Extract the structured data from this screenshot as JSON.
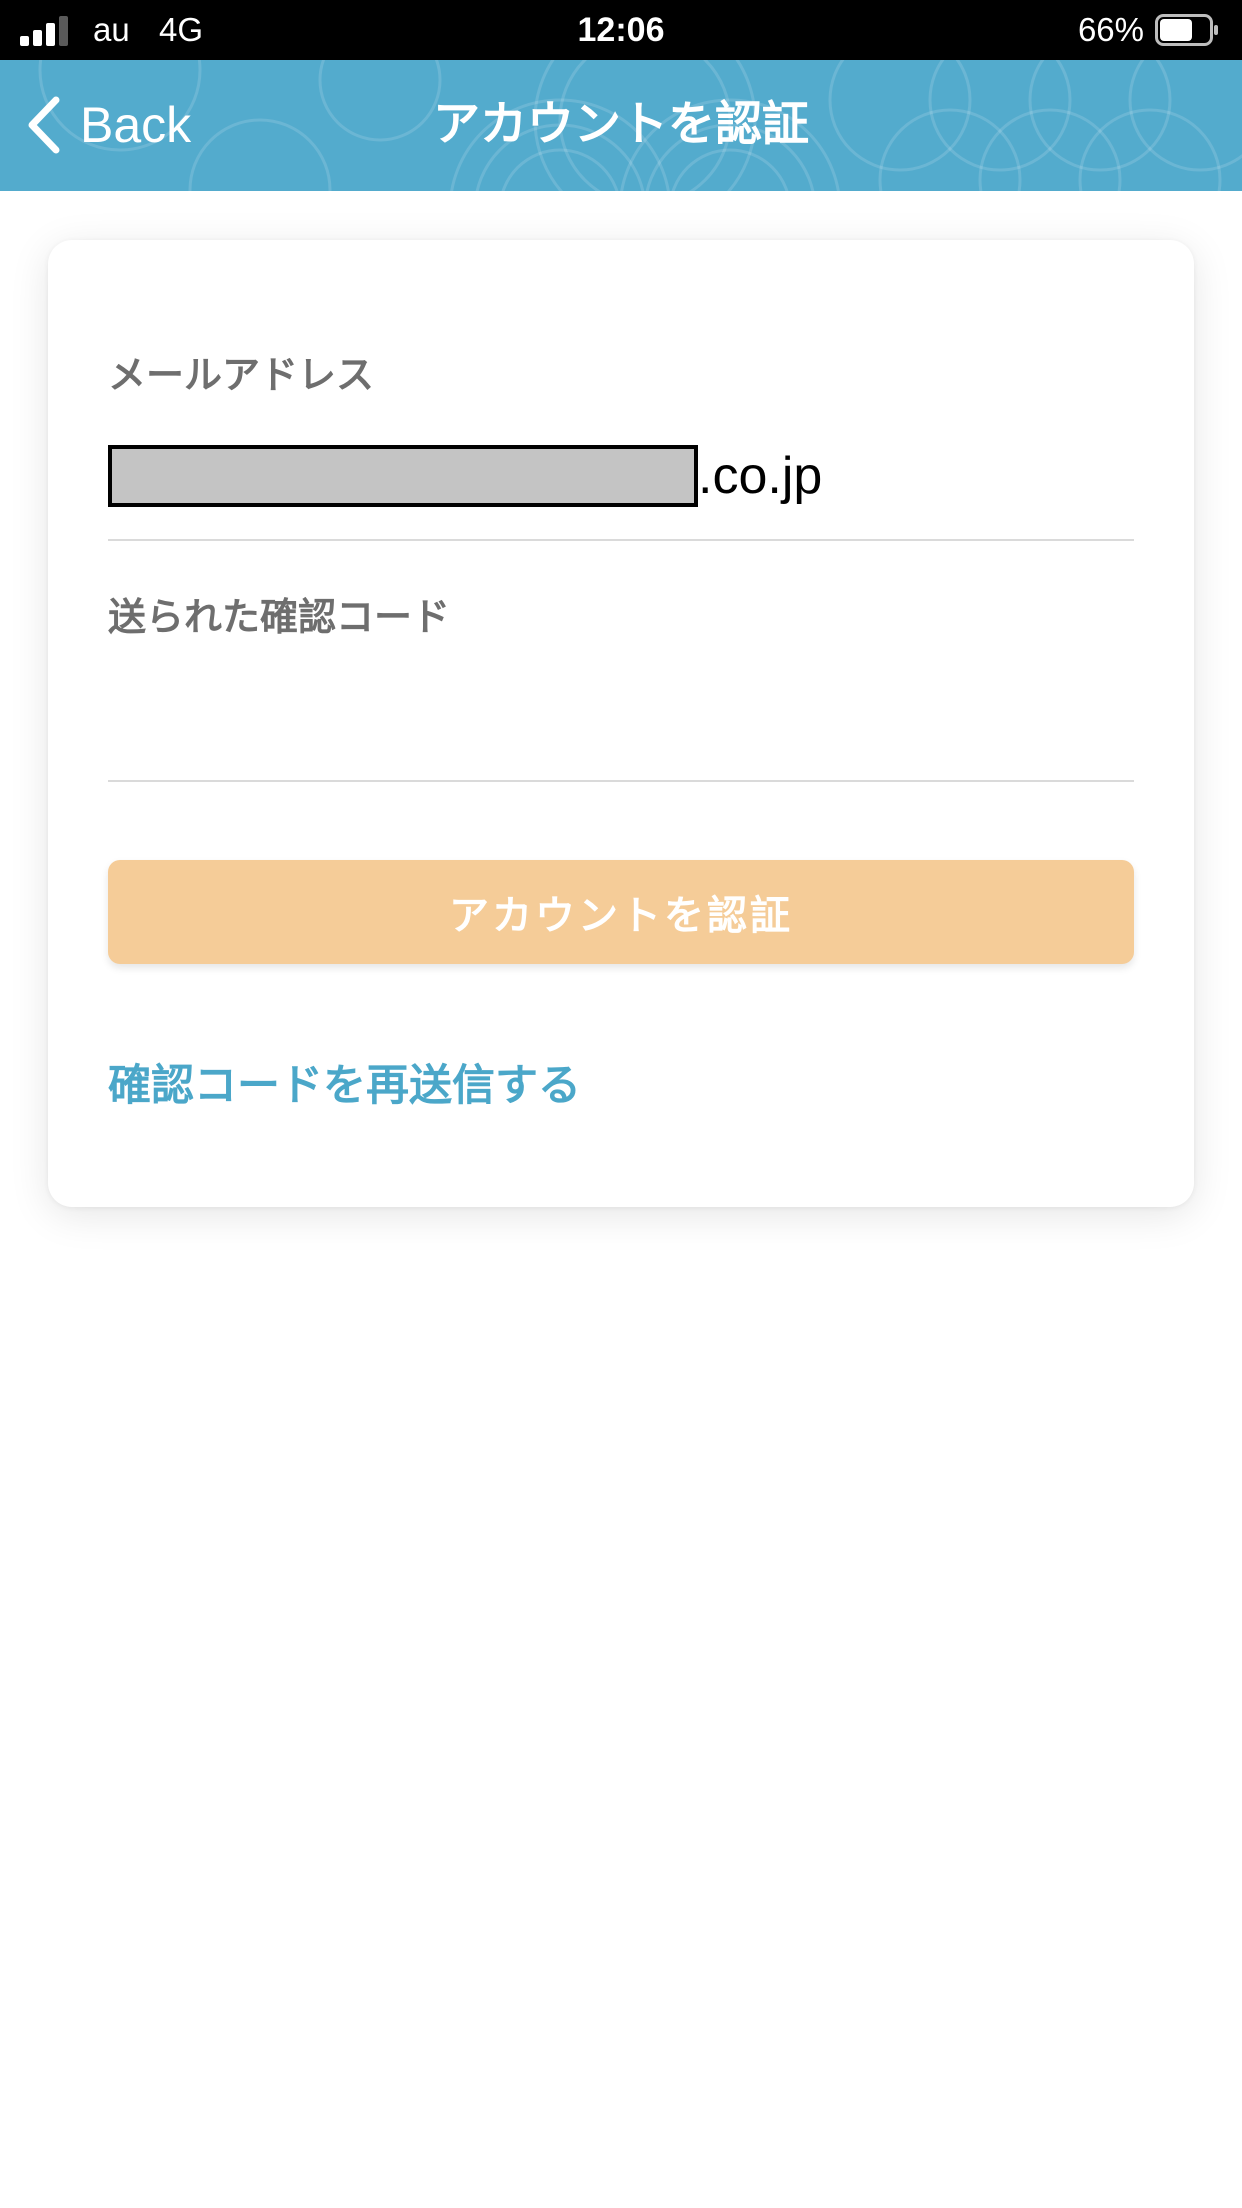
{
  "status_bar": {
    "carrier": "au",
    "network": "4G",
    "time": "12:06",
    "battery_percent": "66%",
    "battery_level": 0.66,
    "signal_icon": "cellular-signal-icon",
    "battery_icon": "battery-icon"
  },
  "nav": {
    "back_label": "Back",
    "back_icon": "chevron-left-icon",
    "title": "アカウントを認証",
    "background_color": "#53abcd"
  },
  "form": {
    "email_label": "メールアドレス",
    "email_suffix": ".co.jp",
    "code_label": "送られた確認コード",
    "code_value": "",
    "submit_label": "アカウントを認証",
    "submit_color": "#f5cc98",
    "resend_label": "確認コードを再送信する",
    "link_color": "#4ba7c9"
  }
}
